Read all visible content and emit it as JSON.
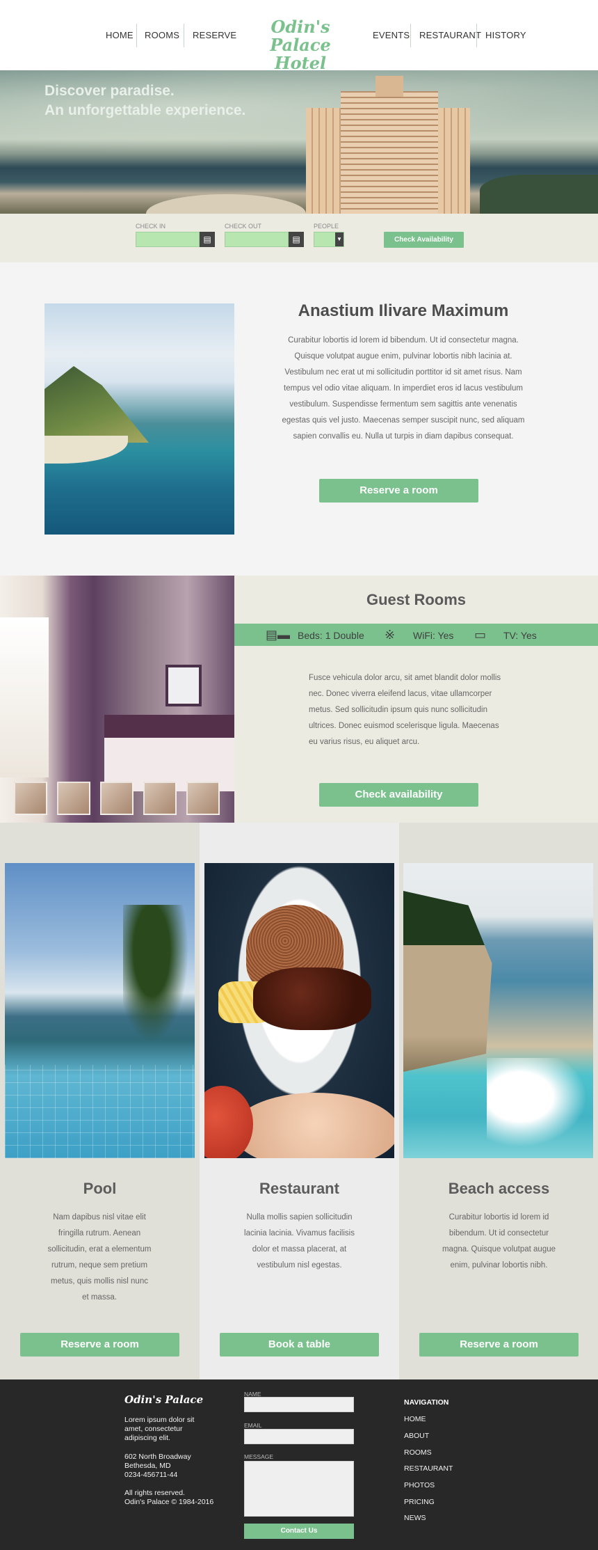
{
  "nav": {
    "left": [
      "HOME",
      "ROOMS",
      "RESERVE"
    ],
    "right": [
      "EVENTS",
      "RESTAURANT",
      "HISTORY"
    ],
    "logo_line1": "Odin's Palace",
    "logo_line2": "Hotel"
  },
  "hero": {
    "line1": "Discover paradise.",
    "line2": "An unforgettable experience."
  },
  "booking": {
    "check_in_label": "CHECK IN",
    "check_out_label": "CHECK OUT",
    "people_label": "PEOPLE",
    "check_in_value": "",
    "check_out_value": "",
    "people_value": "",
    "submit_label": "Check Availability"
  },
  "about": {
    "title": "Anastium Ilivare Maximum",
    "text": "Curabitur lobortis id lorem id bibendum. Ut id consectetur magna. Quisque volutpat augue enim, pulvinar lobortis nibh lacinia at. Vestibulum nec erat ut mi sollicitudin porttitor id sit amet risus. Nam tempus vel odio vitae aliquam. In imperdiet eros id lacus vestibulum vestibulum. Suspendisse fermentum sem sagittis ante venenatis egestas quis vel justo. Maecenas semper suscipit nunc, sed aliquam sapien convallis eu. Nulla ut turpis in diam dapibus consequat.",
    "button": "Reserve a room"
  },
  "rooms": {
    "title": "Guest Rooms",
    "beds": "Beds: 1 Double",
    "wifi": "WiFi: Yes",
    "tv": "TV: Yes",
    "text": "Fusce vehicula dolor arcu, sit amet blandit dolor mollis nec. Donec viverra eleifend lacus, vitae ullamcorper metus. Sed sollicitudin ipsum quis nunc sollicitudin ultrices. Donec euismod scelerisque ligula. Maecenas eu varius risus, eu aliquet arcu.",
    "button": "Check availability"
  },
  "features": [
    {
      "title": "Pool",
      "text": "Nam dapibus nisl vitae elit fringilla rutrum. Aenean sollicitudin, erat a elementum rutrum, neque sem pretium metus, quis mollis nisl nunc et massa.",
      "button": "Reserve a room"
    },
    {
      "title": "Restaurant",
      "text": "Nulla mollis sapien sollicitudin lacinia lacinia. Vivamus facilisis dolor et massa placerat, at vestibulum nisl egestas.",
      "button": "Book a table"
    },
    {
      "title": "Beach access",
      "text": "Curabitur lobortis id lorem id bibendum. Ut id consectetur magna. Quisque volutpat augue enim, pulvinar lobortis nibh.",
      "button": "Reserve a room"
    }
  ],
  "footer": {
    "logo": "Odin's Palace",
    "about_lines": [
      "Lorem ipsum dolor sit",
      "amet, consectetur",
      "adipiscing elit."
    ],
    "address_lines": [
      "602 North Broadway",
      "Bethesda, MD",
      "0234-456711-44"
    ],
    "rights_lines": [
      "All rights reserved.",
      "Odin's Palace © 1984-2016"
    ],
    "name_label": "NAME",
    "email_label": "EMAIL",
    "message_label": "MESSAGE",
    "contact_button": "Contact Us",
    "nav_title": "NAVIGATION",
    "nav_links": [
      "HOME",
      "ABOUT",
      "ROOMS",
      "RESTAURANT",
      "PHOTOS",
      "PRICING",
      "NEWS"
    ]
  },
  "colors": {
    "accent": "#7ac18d",
    "footer_bg": "#282828",
    "booking_bg": "#ecebe2"
  }
}
